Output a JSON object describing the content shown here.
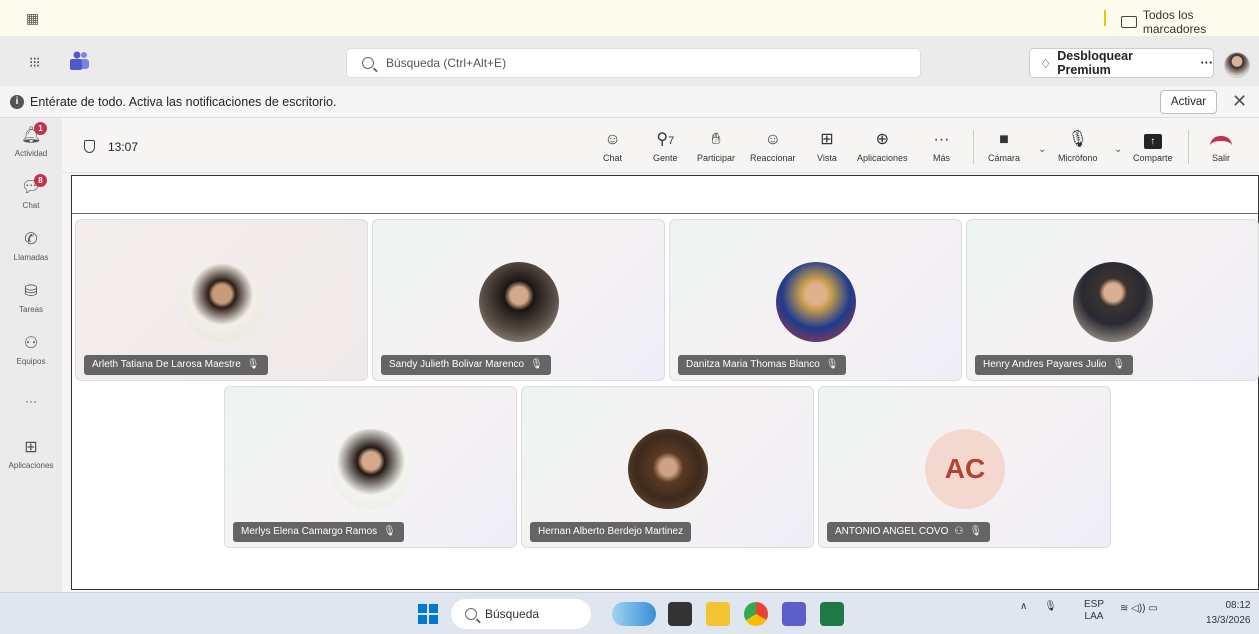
{
  "browser": {
    "bookmarks_folder": "Todos los marcadores"
  },
  "header": {
    "search_placeholder": "Búsqueda (Ctrl+Alt+E)",
    "premium_label": "Desbloquear Premium",
    "premium_more": "···"
  },
  "banner": {
    "text": "Entérate de todo. Activa las notificaciones de escritorio.",
    "action_label": "Activar"
  },
  "rail": {
    "items": [
      {
        "label": "Actividad",
        "icon": "bell-icon",
        "badge": "1"
      },
      {
        "label": "Chat",
        "icon": "chat-icon",
        "badge": "8"
      },
      {
        "label": "Llamadas",
        "icon": "phone-icon",
        "badge": ""
      },
      {
        "label": "Tareas",
        "icon": "tasks-icon",
        "badge": ""
      },
      {
        "label": "Equipos",
        "icon": "teams-icon",
        "badge": ""
      },
      {
        "label": "···",
        "icon": "more-icon",
        "badge": ""
      },
      {
        "label": "Aplicaciones",
        "icon": "apps-icon",
        "badge": ""
      }
    ]
  },
  "meeting": {
    "time": "13:07",
    "people_count": "7",
    "toolbar": {
      "chat": "Chat",
      "people": "Gente",
      "raise": "Participar",
      "react": "Reaccionar",
      "view": "Vista",
      "apps": "Aplicaciones",
      "more": "Más",
      "camera": "Cámara",
      "mic": "Micrófono",
      "share": "Comparte",
      "leave": "Salir"
    },
    "participants": [
      {
        "name": "Arleth Tatiana De Larosa Maestre",
        "muted": true
      },
      {
        "name": "Sandy Julieth Bolivar Marenco",
        "muted": true
      },
      {
        "name": "Danitza Maria Thomas Blanco",
        "muted": true
      },
      {
        "name": "Henry Andres Payares Julio",
        "muted": true
      },
      {
        "name": "Merlys Elena Camargo Ramos",
        "muted": true
      },
      {
        "name": "Hernan Alberto Berdejo Martinez",
        "muted": false
      },
      {
        "name": "ANTONIO ANGEL COVO",
        "muted": true,
        "initials": "AC"
      }
    ]
  },
  "taskbar": {
    "search_label": "Búsqueda",
    "lang": "ESP",
    "lang_sub": "LAA",
    "time": "08:12",
    "date": "13/3/2026"
  },
  "colors": {
    "accent": "#5b5fc7",
    "badge": "#c4314b",
    "hangup": "#c4314b"
  }
}
